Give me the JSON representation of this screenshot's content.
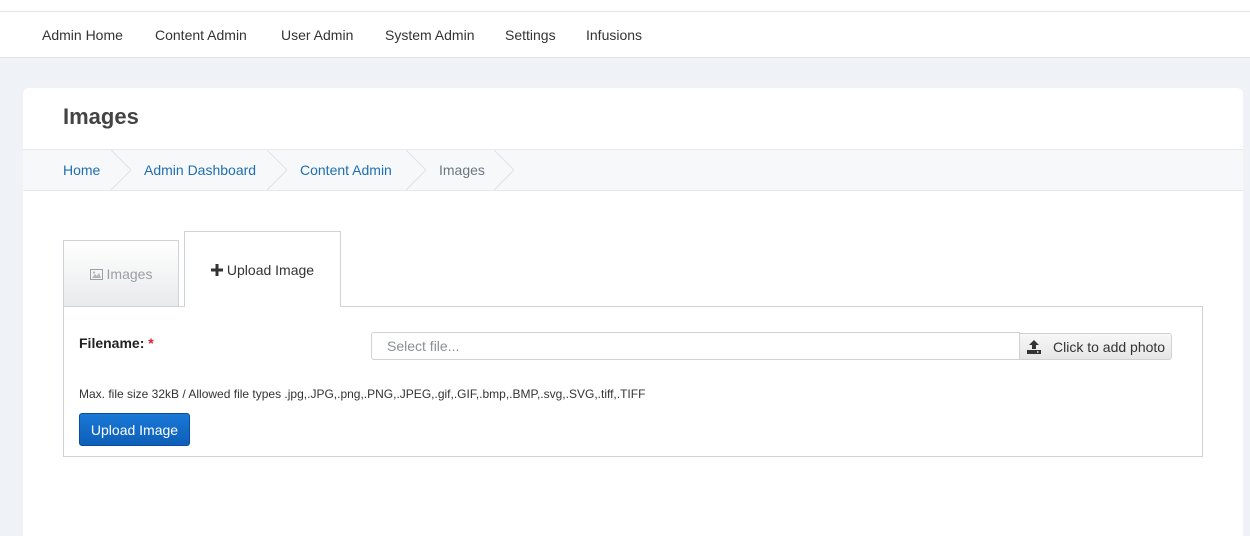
{
  "nav": {
    "items": [
      "Admin Home",
      "Content Admin",
      "User Admin",
      "System Admin",
      "Settings",
      "Infusions"
    ]
  },
  "page": {
    "title": "Images"
  },
  "breadcrumb": {
    "items": [
      "Home",
      "Admin Dashboard",
      "Content Admin",
      "Images"
    ]
  },
  "tabs": {
    "images_label": "Images",
    "upload_label": "Upload Image",
    "active": "Upload Image"
  },
  "form": {
    "filename_label": "Filename:",
    "required_mark": "*",
    "file_placeholder": "Select file...",
    "browse_label": "Click to add photo",
    "hint": "Max. file size 32kB / Allowed file types .jpg,.JPG,.png,.PNG,.JPEG,.gif,.GIF,.bmp,.BMP,.svg,.SVG,.tiff,.TIFF",
    "submit_label": "Upload Image"
  },
  "colors": {
    "link": "#1f6fb0",
    "primary_button": "#0d5fb8",
    "required": "#d9232d",
    "background": "#eff3f7"
  }
}
